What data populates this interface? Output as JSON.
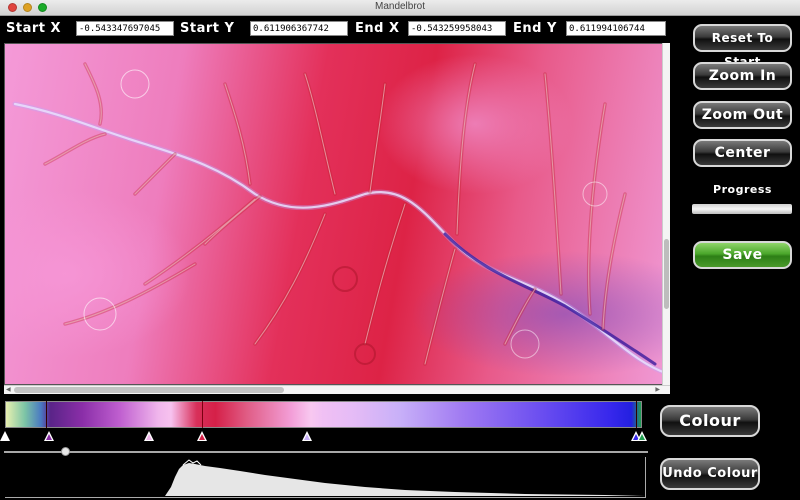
{
  "window": {
    "title": "Mandelbrot"
  },
  "coords": {
    "start_x_label": "Start X",
    "start_x_value": "-0.543347697045",
    "start_y_label": "Start Y",
    "start_y_value": "0.611906367742",
    "end_x_label": "End X",
    "end_x_value": "-0.543259958043",
    "end_y_label": "End Y",
    "end_y_value": "0.611994106744"
  },
  "buttons": {
    "reset": "Reset To Start",
    "zoom_in": "Zoom In",
    "zoom_out": "Zoom Out",
    "center": "Center",
    "save": "Save",
    "colour": "Colour",
    "undo_colour": "Undo Colour"
  },
  "progress": {
    "label": "Progress",
    "value": 0
  },
  "colors": {
    "save_button": "#4aa72b",
    "palette_markers": [
      "#ffffff",
      "#8a2ea8",
      "#f0b6ec",
      "#d52048",
      "#c8b0f8",
      "#3828ec",
      "#20a050"
    ]
  },
  "icons": {
    "close": "close-icon",
    "minimize": "minimize-icon",
    "zoom": "zoom-window-icon"
  }
}
